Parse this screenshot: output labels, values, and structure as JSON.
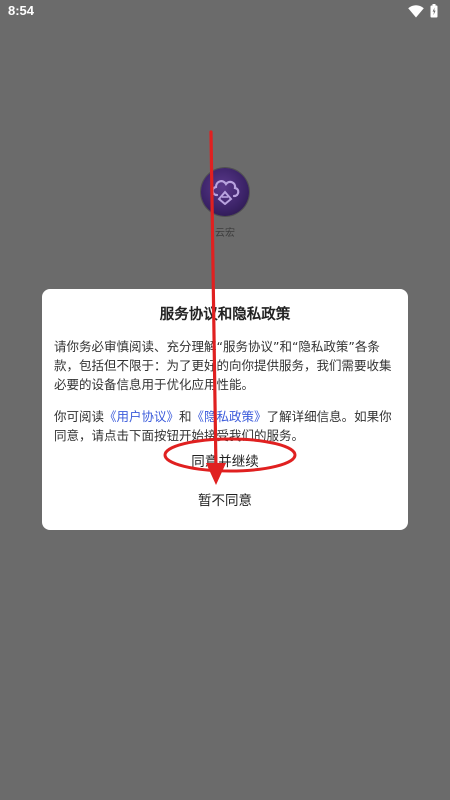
{
  "status_bar": {
    "time": "8:54",
    "icons": [
      "wifi-icon",
      "battery-icon"
    ],
    "icon_color": "#ffffff"
  },
  "home": {
    "app_label": "云宏",
    "app_icon": "cloud-logo-icon",
    "background_color": "#6b6b6b"
  },
  "dialog": {
    "title": "服务协议和隐私政策",
    "paragraph1": "请你务必审慎阅读、充分理解“服务协议”和“隐私政策”各条款，包括但不限于：为了更好的向你提供服务，我们需要收集必要的设备信息用于优化应用性能。",
    "p2_prefix": "你可阅读",
    "user_agreement_link": "《用户协议》",
    "p2_and": "和",
    "privacy_policy_link": "《隐私政策》",
    "p2_suffix": "了解详细信息。如果你同意，请点击下面按钮开始接受我们的服务。",
    "agree_button": "同意并继续",
    "disagree_button": "暂不同意",
    "link_color": "#3b5bdb"
  },
  "annotation": {
    "arrow_color": "#e02020",
    "highlight_target": "agree-button"
  }
}
